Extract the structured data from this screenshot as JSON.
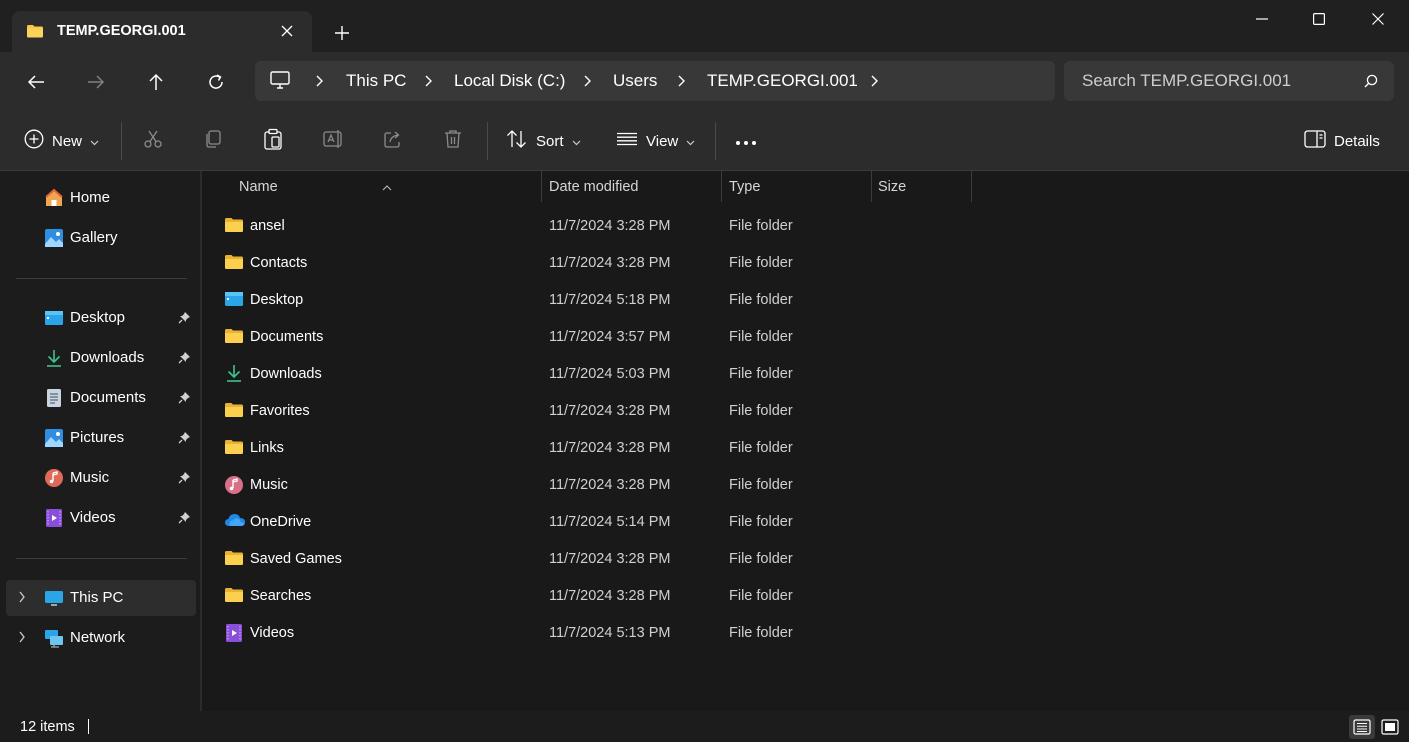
{
  "tab": {
    "title": "TEMP.GEORGI.001",
    "icon": "folder-icon"
  },
  "window": {
    "minimize": "minimize-icon",
    "maximize": "maximize-icon",
    "close": "close-icon"
  },
  "address": {
    "crumbs": [
      "This PC",
      "Local Disk (C:)",
      "Users",
      "TEMP.GEORGI.001"
    ],
    "search_placeholder": "Search TEMP.GEORGI.001"
  },
  "toolbar": {
    "new_label": "New",
    "sort_label": "Sort",
    "view_label": "View",
    "details_label": "Details"
  },
  "sidebar": {
    "quick": [
      {
        "label": "Home",
        "icon": "home-icon"
      },
      {
        "label": "Gallery",
        "icon": "gallery-icon"
      }
    ],
    "pinned": [
      {
        "label": "Desktop",
        "icon": "desktop-icon"
      },
      {
        "label": "Downloads",
        "icon": "download-icon"
      },
      {
        "label": "Documents",
        "icon": "document-icon"
      },
      {
        "label": "Pictures",
        "icon": "pictures-icon"
      },
      {
        "label": "Music",
        "icon": "music-icon"
      },
      {
        "label": "Videos",
        "icon": "videos-icon"
      }
    ],
    "locations": [
      {
        "label": "This PC",
        "icon": "pc-icon",
        "selected": true
      },
      {
        "label": "Network",
        "icon": "network-icon"
      }
    ]
  },
  "columns": {
    "name": "Name",
    "date": "Date modified",
    "type": "Type",
    "size": "Size"
  },
  "files": [
    {
      "name": "ansel",
      "date": "11/7/2024 3:28 PM",
      "type": "File folder",
      "icon": "folder-icon"
    },
    {
      "name": "Contacts",
      "date": "11/7/2024 3:28 PM",
      "type": "File folder",
      "icon": "folder-icon"
    },
    {
      "name": "Desktop",
      "date": "11/7/2024 5:18 PM",
      "type": "File folder",
      "icon": "desktop-icon"
    },
    {
      "name": "Documents",
      "date": "11/7/2024 3:57 PM",
      "type": "File folder",
      "icon": "folder-icon"
    },
    {
      "name": "Downloads",
      "date": "11/7/2024 5:03 PM",
      "type": "File folder",
      "icon": "download-icon"
    },
    {
      "name": "Favorites",
      "date": "11/7/2024 3:28 PM",
      "type": "File folder",
      "icon": "folder-icon"
    },
    {
      "name": "Links",
      "date": "11/7/2024 3:28 PM",
      "type": "File folder",
      "icon": "folder-icon"
    },
    {
      "name": "Music",
      "date": "11/7/2024 3:28 PM",
      "type": "File folder",
      "icon": "music-icon"
    },
    {
      "name": "OneDrive",
      "date": "11/7/2024 5:14 PM",
      "type": "File folder",
      "icon": "cloud-icon"
    },
    {
      "name": "Saved Games",
      "date": "11/7/2024 3:28 PM",
      "type": "File folder",
      "icon": "folder-icon"
    },
    {
      "name": "Searches",
      "date": "11/7/2024 3:28 PM",
      "type": "File folder",
      "icon": "folder-icon"
    },
    {
      "name": "Videos",
      "date": "11/7/2024 5:13 PM",
      "type": "File folder",
      "icon": "videos-icon"
    }
  ],
  "status": {
    "count": "12 items"
  },
  "colors": {
    "folder": "#f8c845",
    "accent": "#4cc2ff",
    "background": "#191919"
  }
}
